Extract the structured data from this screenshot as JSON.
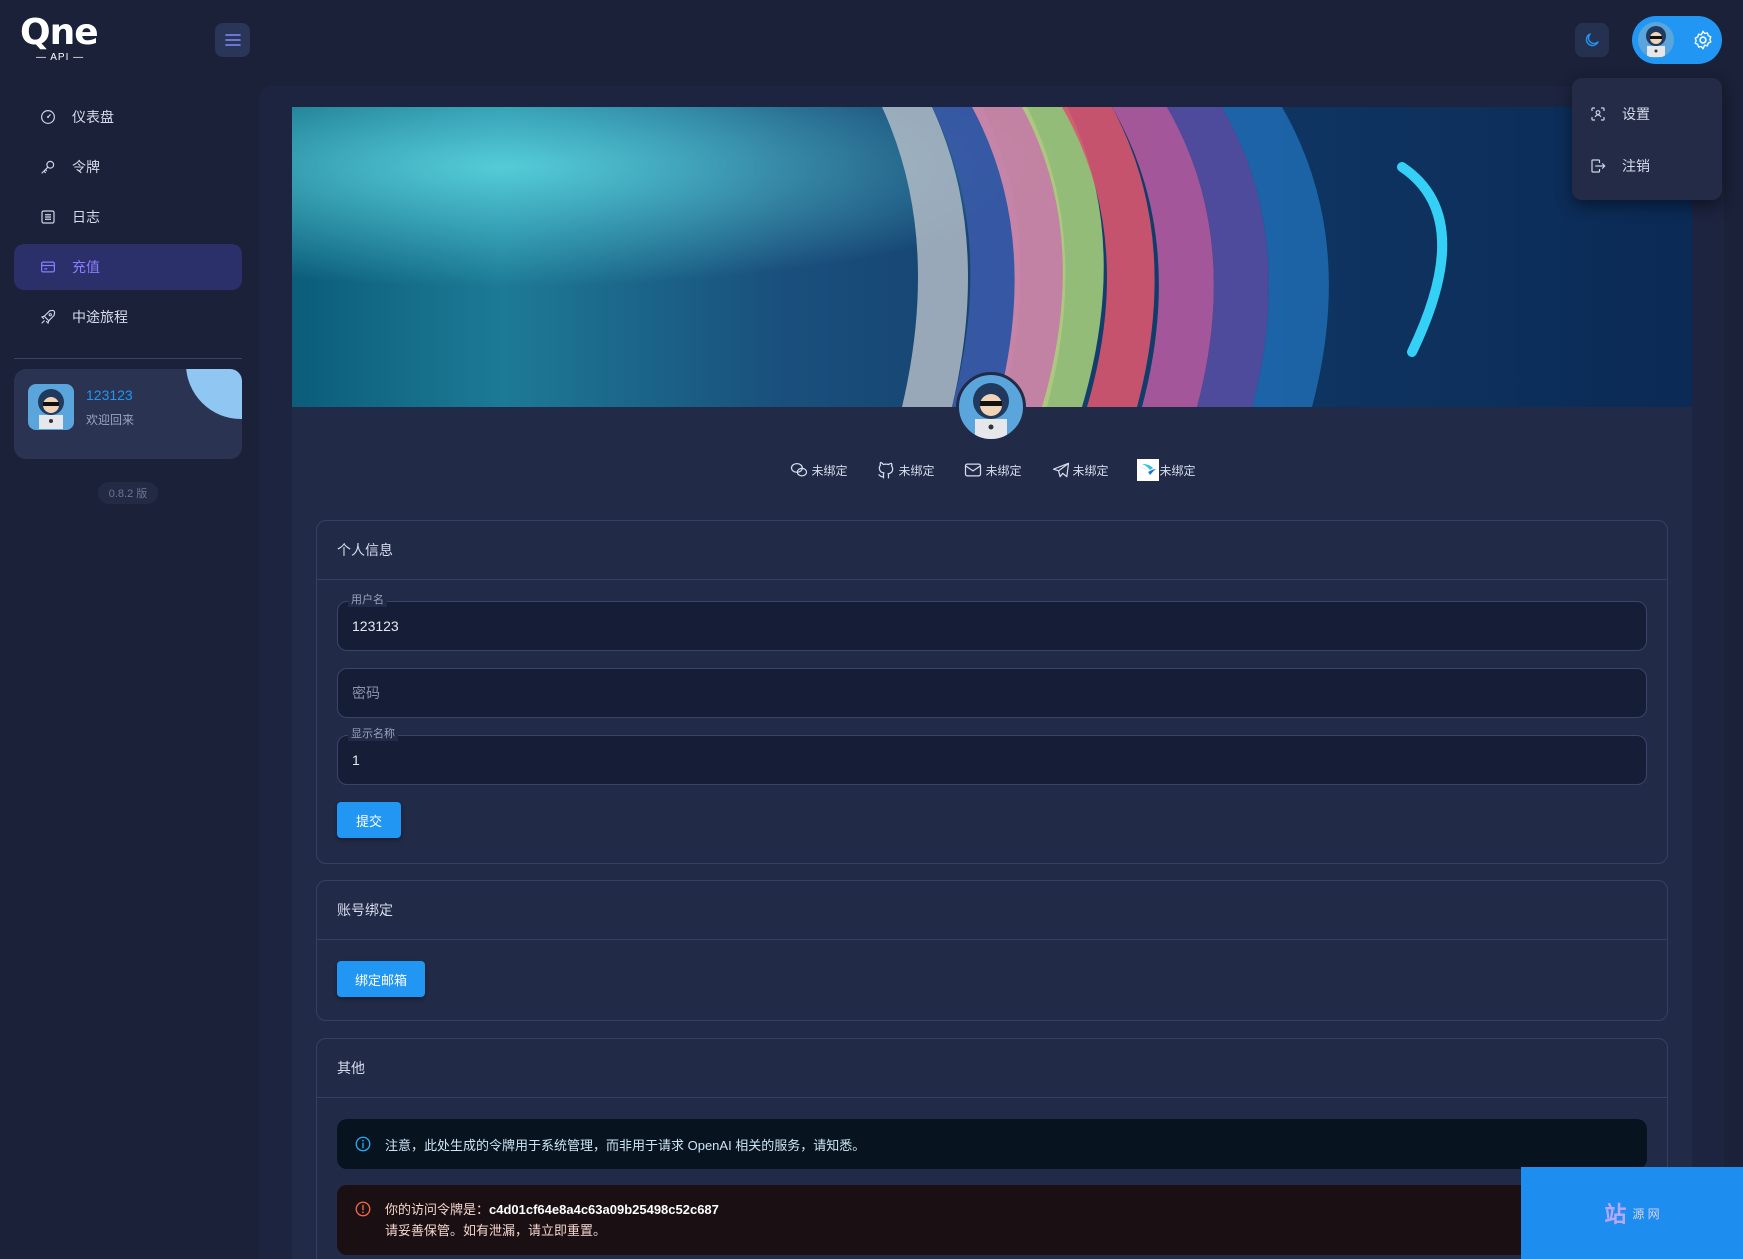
{
  "brand": {
    "logo_text": "Qne",
    "logo_sub": "— API —"
  },
  "sidebar": {
    "items": [
      {
        "label": "仪表盘",
        "icon": "dashboard-icon"
      },
      {
        "label": "令牌",
        "icon": "key-icon"
      },
      {
        "label": "日志",
        "icon": "log-icon"
      },
      {
        "label": "充值",
        "icon": "wallet-icon",
        "active": true
      },
      {
        "label": "中途旅程",
        "icon": "rocket-icon"
      }
    ],
    "user": {
      "name": "123123",
      "welcome": "欢迎回来"
    },
    "version": "0.8.2 版"
  },
  "dropdown": {
    "items": [
      {
        "label": "设置",
        "icon": "user-scan-icon"
      },
      {
        "label": "注销",
        "icon": "logout-icon"
      }
    ]
  },
  "binds": [
    {
      "label": "未绑定",
      "icon": "wechat-icon"
    },
    {
      "label": "未绑定",
      "icon": "github-icon"
    },
    {
      "label": "未绑定",
      "icon": "email-icon"
    },
    {
      "label": "未绑定",
      "icon": "telegram-icon"
    },
    {
      "label": "未绑定",
      "icon": "lark-icon"
    }
  ],
  "personal": {
    "title": "个人信息",
    "username_label": "用户名",
    "username_value": "123123",
    "password_placeholder": "密码",
    "display_name_label": "显示名称",
    "display_name_value": "1",
    "submit": "提交"
  },
  "binding": {
    "title": "账号绑定",
    "bind_email": "绑定邮箱"
  },
  "other": {
    "title": "其他",
    "info": "注意，此处生成的令牌用于系统管理，而非用于请求 OpenAI 相关的服务，请知悉。",
    "token_prefix": "你的访问令牌是：",
    "token_value": "c4d01cf64e8a4c63a09b25498c52c687",
    "token_warn": "请妥善保管。如有泄漏，请立即重置。"
  },
  "watermark": {
    "main": "站",
    "small": "源 网"
  },
  "colors": {
    "accent": "#2196f3",
    "active_nav": "#8a7dff",
    "bg": "#1a2138"
  }
}
